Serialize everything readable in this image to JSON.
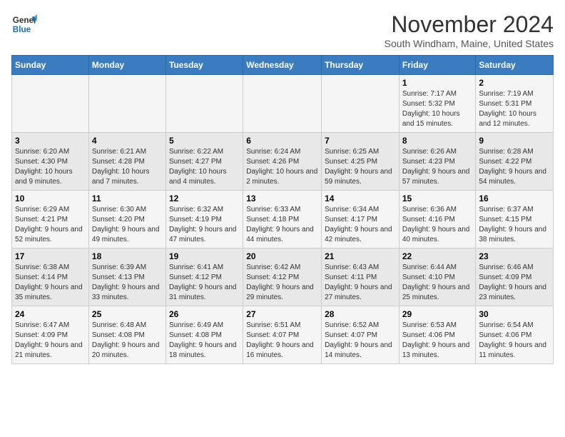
{
  "logo": {
    "line1": "General",
    "line2": "Blue"
  },
  "title": "November 2024",
  "subtitle": "South Windham, Maine, United States",
  "days_of_week": [
    "Sunday",
    "Monday",
    "Tuesday",
    "Wednesday",
    "Thursday",
    "Friday",
    "Saturday"
  ],
  "weeks": [
    [
      {
        "day": "",
        "info": ""
      },
      {
        "day": "",
        "info": ""
      },
      {
        "day": "",
        "info": ""
      },
      {
        "day": "",
        "info": ""
      },
      {
        "day": "",
        "info": ""
      },
      {
        "day": "1",
        "info": "Sunrise: 7:17 AM\nSunset: 5:32 PM\nDaylight: 10 hours and 15 minutes."
      },
      {
        "day": "2",
        "info": "Sunrise: 7:19 AM\nSunset: 5:31 PM\nDaylight: 10 hours and 12 minutes."
      }
    ],
    [
      {
        "day": "3",
        "info": "Sunrise: 6:20 AM\nSunset: 4:30 PM\nDaylight: 10 hours and 9 minutes."
      },
      {
        "day": "4",
        "info": "Sunrise: 6:21 AM\nSunset: 4:28 PM\nDaylight: 10 hours and 7 minutes."
      },
      {
        "day": "5",
        "info": "Sunrise: 6:22 AM\nSunset: 4:27 PM\nDaylight: 10 hours and 4 minutes."
      },
      {
        "day": "6",
        "info": "Sunrise: 6:24 AM\nSunset: 4:26 PM\nDaylight: 10 hours and 2 minutes."
      },
      {
        "day": "7",
        "info": "Sunrise: 6:25 AM\nSunset: 4:25 PM\nDaylight: 9 hours and 59 minutes."
      },
      {
        "day": "8",
        "info": "Sunrise: 6:26 AM\nSunset: 4:23 PM\nDaylight: 9 hours and 57 minutes."
      },
      {
        "day": "9",
        "info": "Sunrise: 6:28 AM\nSunset: 4:22 PM\nDaylight: 9 hours and 54 minutes."
      }
    ],
    [
      {
        "day": "10",
        "info": "Sunrise: 6:29 AM\nSunset: 4:21 PM\nDaylight: 9 hours and 52 minutes."
      },
      {
        "day": "11",
        "info": "Sunrise: 6:30 AM\nSunset: 4:20 PM\nDaylight: 9 hours and 49 minutes."
      },
      {
        "day": "12",
        "info": "Sunrise: 6:32 AM\nSunset: 4:19 PM\nDaylight: 9 hours and 47 minutes."
      },
      {
        "day": "13",
        "info": "Sunrise: 6:33 AM\nSunset: 4:18 PM\nDaylight: 9 hours and 44 minutes."
      },
      {
        "day": "14",
        "info": "Sunrise: 6:34 AM\nSunset: 4:17 PM\nDaylight: 9 hours and 42 minutes."
      },
      {
        "day": "15",
        "info": "Sunrise: 6:36 AM\nSunset: 4:16 PM\nDaylight: 9 hours and 40 minutes."
      },
      {
        "day": "16",
        "info": "Sunrise: 6:37 AM\nSunset: 4:15 PM\nDaylight: 9 hours and 38 minutes."
      }
    ],
    [
      {
        "day": "17",
        "info": "Sunrise: 6:38 AM\nSunset: 4:14 PM\nDaylight: 9 hours and 35 minutes."
      },
      {
        "day": "18",
        "info": "Sunrise: 6:39 AM\nSunset: 4:13 PM\nDaylight: 9 hours and 33 minutes."
      },
      {
        "day": "19",
        "info": "Sunrise: 6:41 AM\nSunset: 4:12 PM\nDaylight: 9 hours and 31 minutes."
      },
      {
        "day": "20",
        "info": "Sunrise: 6:42 AM\nSunset: 4:12 PM\nDaylight: 9 hours and 29 minutes."
      },
      {
        "day": "21",
        "info": "Sunrise: 6:43 AM\nSunset: 4:11 PM\nDaylight: 9 hours and 27 minutes."
      },
      {
        "day": "22",
        "info": "Sunrise: 6:44 AM\nSunset: 4:10 PM\nDaylight: 9 hours and 25 minutes."
      },
      {
        "day": "23",
        "info": "Sunrise: 6:46 AM\nSunset: 4:09 PM\nDaylight: 9 hours and 23 minutes."
      }
    ],
    [
      {
        "day": "24",
        "info": "Sunrise: 6:47 AM\nSunset: 4:09 PM\nDaylight: 9 hours and 21 minutes."
      },
      {
        "day": "25",
        "info": "Sunrise: 6:48 AM\nSunset: 4:08 PM\nDaylight: 9 hours and 20 minutes."
      },
      {
        "day": "26",
        "info": "Sunrise: 6:49 AM\nSunset: 4:08 PM\nDaylight: 9 hours and 18 minutes."
      },
      {
        "day": "27",
        "info": "Sunrise: 6:51 AM\nSunset: 4:07 PM\nDaylight: 9 hours and 16 minutes."
      },
      {
        "day": "28",
        "info": "Sunrise: 6:52 AM\nSunset: 4:07 PM\nDaylight: 9 hours and 14 minutes."
      },
      {
        "day": "29",
        "info": "Sunrise: 6:53 AM\nSunset: 4:06 PM\nDaylight: 9 hours and 13 minutes."
      },
      {
        "day": "30",
        "info": "Sunrise: 6:54 AM\nSunset: 4:06 PM\nDaylight: 9 hours and 11 minutes."
      }
    ]
  ]
}
